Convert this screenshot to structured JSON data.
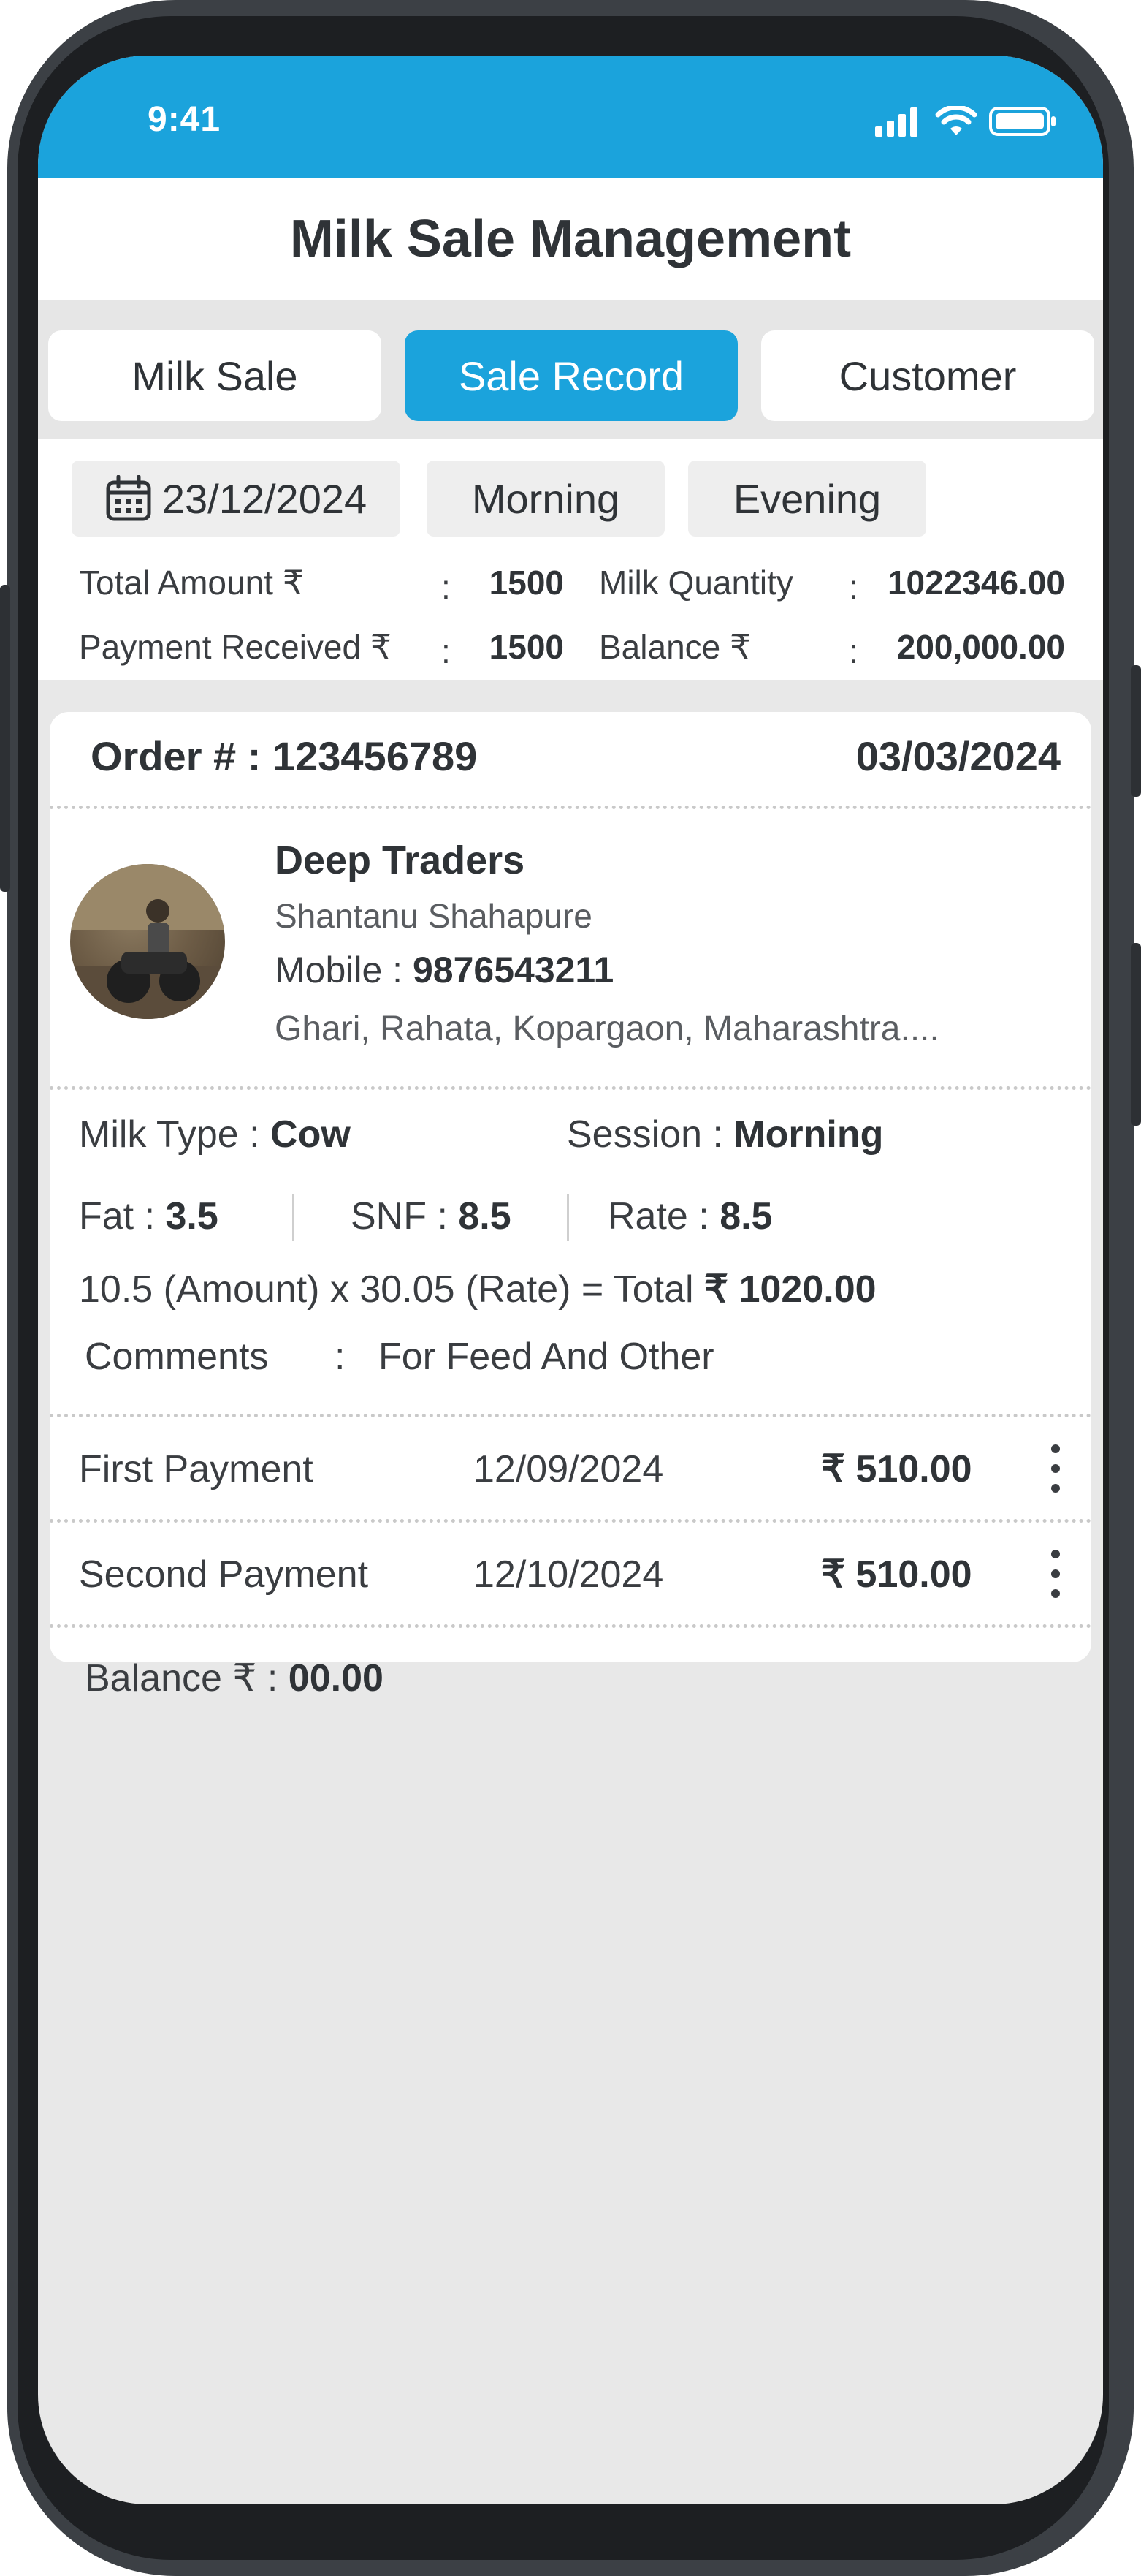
{
  "status_bar": {
    "time": "9:41"
  },
  "header": {
    "title": "Milk Sale Management"
  },
  "tabs": [
    {
      "label": "Milk Sale"
    },
    {
      "label": "Sale Record"
    },
    {
      "label": "Customer"
    }
  ],
  "filters": {
    "date": "23/12/2024",
    "session_morning": "Morning",
    "session_evening": "Evening"
  },
  "summary": {
    "total_amount_label": "Total Amount ₹",
    "total_amount_value": "1500",
    "milk_quantity_label": "Milk Quantity",
    "milk_quantity_value": "1022346.00",
    "payment_received_label": "Payment Received ₹",
    "payment_received_value": "1500",
    "balance_label": "Balance ₹",
    "balance_value": "200,000.00",
    "colon": ":"
  },
  "order": {
    "number_label": "Order # : ",
    "number": "123456789",
    "date": "03/03/2024",
    "customer_business": "Deep Traders",
    "customer_name": "Shantanu Shahapure",
    "mobile_label": "Mobile : ",
    "mobile": "9876543211",
    "address": "Ghari, Rahata, Kopargaon, Maharashtra....",
    "milk_type_label": "Milk Type : ",
    "milk_type": "Cow",
    "session_label": "Session : ",
    "session": "Morning",
    "fat_label": "Fat : ",
    "fat": "3.5",
    "snf_label": "SNF : ",
    "snf": "8.5",
    "rate_label": "Rate : ",
    "rate": "8.5",
    "calc_text": "10.5 (Amount) x 30.05 (Rate) = Total ",
    "calc_total": "₹ 1020.00",
    "comments_label": "Comments",
    "comments_colon": ":",
    "comments": "For Feed And Other",
    "payments": [
      {
        "label": "First Payment",
        "date": "12/09/2024",
        "amount": "₹ 510.00"
      },
      {
        "label": "Second Payment",
        "date": "12/10/2024",
        "amount": "₹ 510.00"
      }
    ],
    "balance_label": "Balance ₹ : ",
    "balance": "00.00"
  },
  "colors": {
    "accent": "#1ba3dc",
    "background": "#e8e8e8",
    "text": "#2f3337"
  },
  "icons": [
    "signal-icon",
    "wifi-icon",
    "battery-icon",
    "calendar-icon",
    "kebab-menu-icon"
  ]
}
